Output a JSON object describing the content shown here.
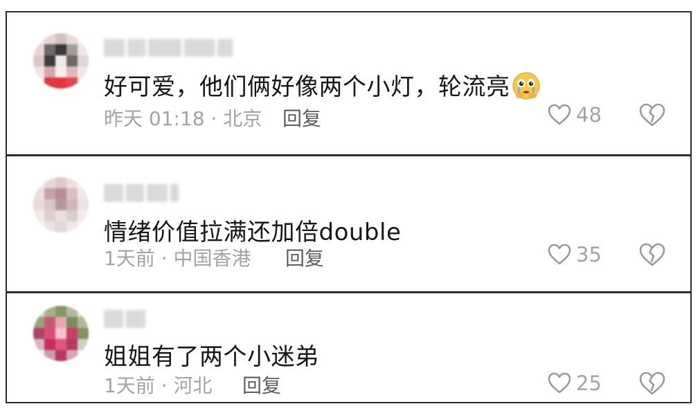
{
  "comments": [
    {
      "text": "好可爱，他们俩好像两个小灯，轮流亮",
      "emoji": "crying-face-emoji",
      "meta": "昨天 01:18 · 北京",
      "reply_label": "回复",
      "likes": "48"
    },
    {
      "text": "情绪价值拉满还加倍double",
      "meta": "1天前 · 中国香港",
      "reply_label": "回复",
      "likes": "35"
    },
    {
      "text": "姐姐有了两个小迷弟",
      "meta": "1天前 · 河北",
      "reply_label": "回复",
      "likes": "25"
    }
  ],
  "icons": {
    "like": "heart-outline-icon",
    "dislike": "broken-heart-icon"
  },
  "colors": {
    "text": "#161616",
    "meta": "#a3a3a3",
    "reply": "#5c5c5c",
    "border": "#2b2b2b"
  }
}
